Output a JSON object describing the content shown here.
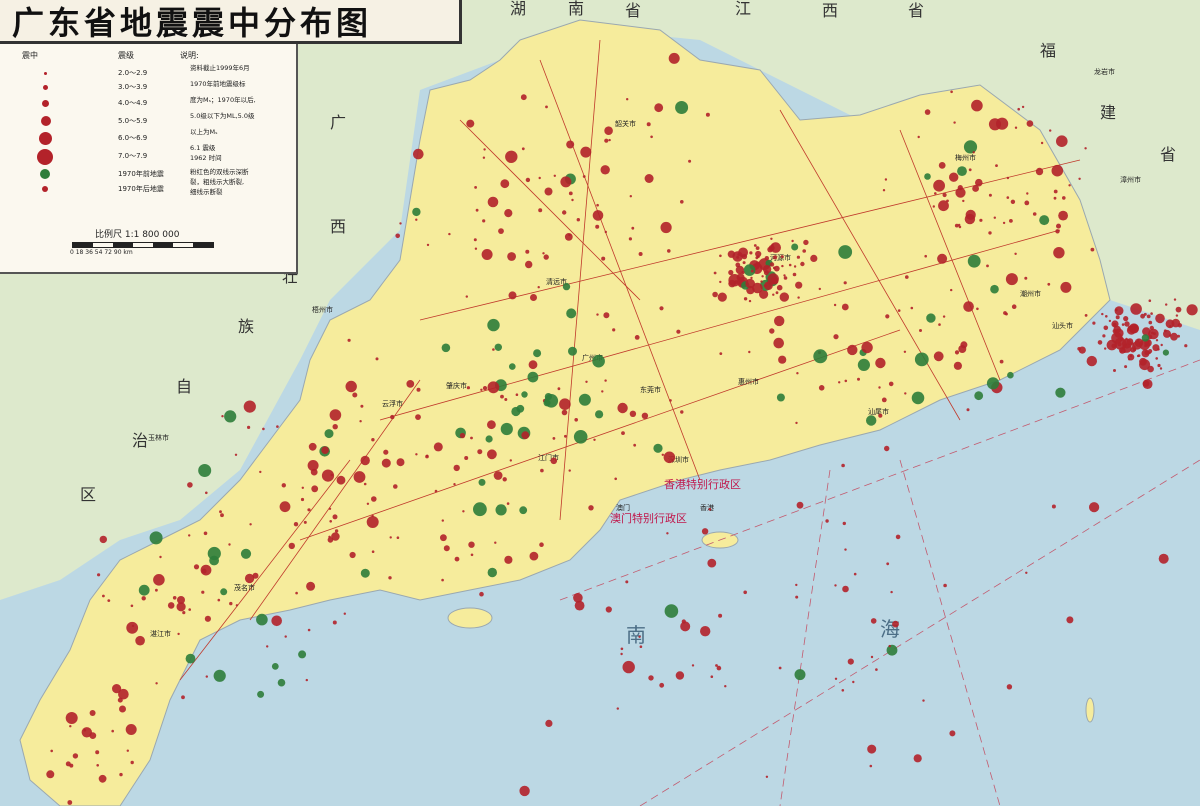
{
  "title": "广东省地震震中分布图",
  "legend": {
    "col_epicenter": "震中",
    "col_magnitude": "震级",
    "col_notes": "说明:",
    "rows": [
      {
        "mag": "2.0～2.9",
        "color": "#b3222a"
      },
      {
        "mag": "3.0～3.9",
        "color": "#b3222a"
      },
      {
        "mag": "4.0～4.9",
        "color": "#b3222a"
      },
      {
        "mag": "5.0～5.9",
        "color": "#b3222a"
      },
      {
        "mag": "6.0～6.9",
        "color": "#b3222a"
      },
      {
        "mag": "7.0～7.9",
        "color": "#b3222a"
      },
      {
        "mag": "1970年前地震",
        "color": "#2e7d3a"
      },
      {
        "mag": "1970年后地震",
        "color": "#b3222a"
      }
    ],
    "notes": [
      "资料截止1999年6月",
      "1970年前地震级标",
      "度为Mₛ；1970年以后,",
      "5.0级以下为ML,5.0级",
      "以上为Mₛ",
      "6.1 震级",
      "1962 时间",
      "粉红色的双线示深断",
      "裂，粗线示大断裂,",
      "细线示断裂"
    ],
    "scale_label": "比例尺  1:1 800 000",
    "scale_ticks": "0   18   36   54   72   90 km"
  },
  "map_labels": {
    "hunan": "湖",
    "nan": "南",
    "sheng": "省",
    "jiang": "江",
    "xi": "西",
    "sheng2": "省",
    "fu": "福",
    "jian": "建",
    "sheng3": "省",
    "guang": "广",
    "xi2": "西",
    "zhuang": "壮",
    "zu": "族",
    "zi": "自",
    "zhi": "治",
    "qu": "区",
    "sea_nan": "南",
    "sea_hai": "海"
  },
  "cities": {
    "guangzhou": "广州市",
    "dongguan": "东莞市",
    "shenzhen": "深圳市",
    "zhaoqing": "肇庆市",
    "jiangmen": "江门市",
    "yunfu": "云浮市",
    "qingyuan": "清远市",
    "shaoguan": "韶关市",
    "heyuan": "河源市",
    "meizhou": "梅州市",
    "chaozhou": "潮州市",
    "shantou": "汕头市",
    "huizhou": "惠州市",
    "shanwei": "汕尾市",
    "maoming": "茂名市",
    "zhanjiang": "湛江市",
    "wuzhou": "梧州市",
    "yulin": "玉林市",
    "longyan": "龙岩市",
    "zhangzhou": "漳州市",
    "macau": "澳门",
    "hongkong": "香港"
  },
  "hk_label": "香港特别行政区",
  "macau_label": "澳门特别行政区",
  "colors": {
    "land_gd": "#f6ec9c",
    "land_other": "#dde9cc",
    "sea": "#bcd8e4",
    "quake_red": "#b3222a",
    "quake_green": "#2e7d3a",
    "fault": "#c0392b"
  }
}
